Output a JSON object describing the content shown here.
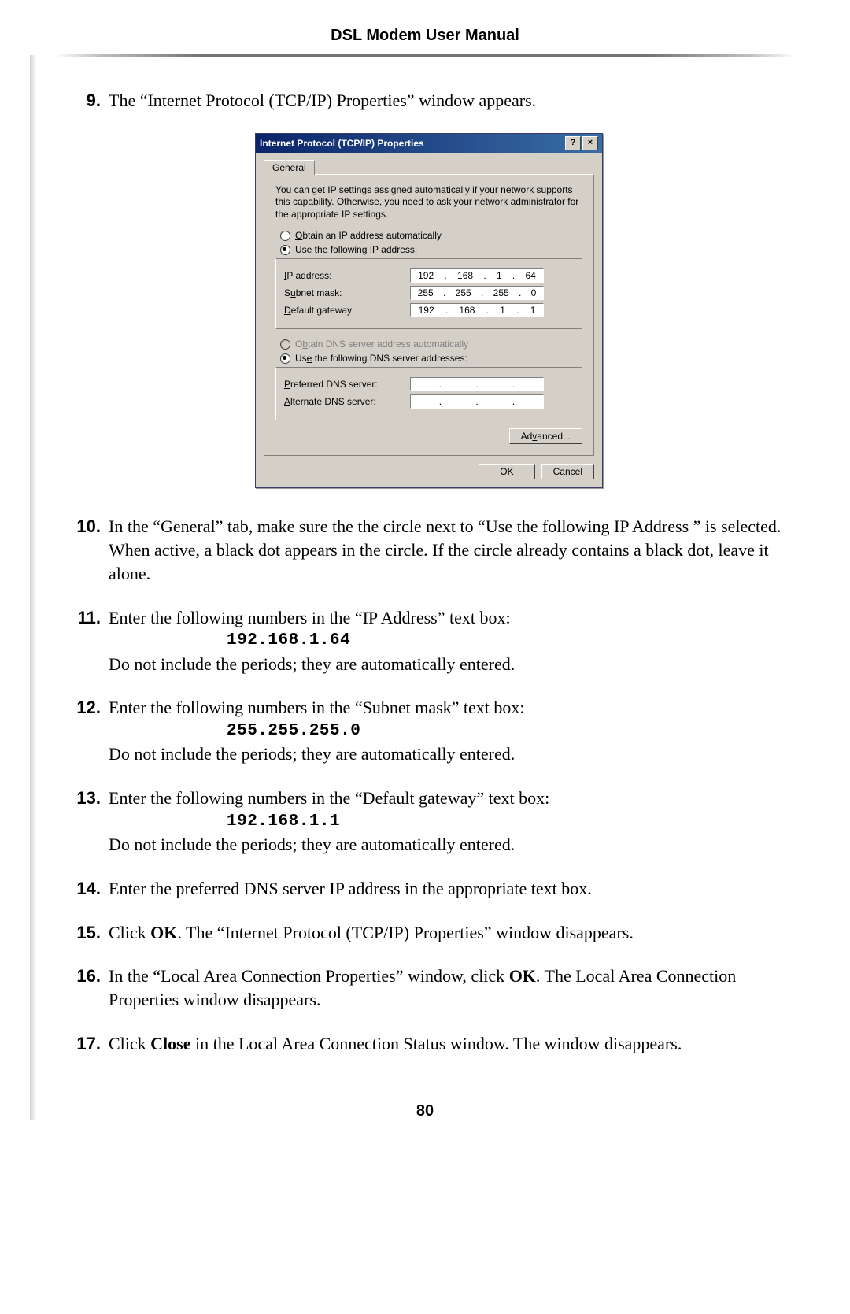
{
  "header": "DSL Modem User Manual",
  "page": "80",
  "steps": {
    "s9": {
      "num": "9.",
      "text": "The “Internet Protocol (TCP/IP) Properties” window appears."
    },
    "s10": {
      "num": "10.",
      "text": "In the “General” tab, make sure the the circle next to “Use the following IP Address ” is selected. When active, a black dot appears in the circle. If the circle already contains a black dot, leave it alone."
    },
    "s11": {
      "num": "11.",
      "lead": "Enter the following numbers in the “IP Address” text box:",
      "code": "192.168.1.64",
      "tail": "Do not include the periods; they are automatically entered."
    },
    "s12": {
      "num": "12.",
      "lead": "Enter the following numbers in the “Subnet mask” text box:",
      "code": "255.255.255.0",
      "tail": "Do not include the periods; they are automatically entered."
    },
    "s13": {
      "num": "13.",
      "lead": "Enter the following numbers in the “Default gateway” text box:",
      "code": "192.168.1.1",
      "tail": "Do not include the periods; they are automatically entered."
    },
    "s14": {
      "num": "14.",
      "text": "Enter the preferred DNS server IP address in the appropriate text box."
    },
    "s15": {
      "num": "15.",
      "a": "Click ",
      "ok": "OK",
      "b": ". The “Internet Protocol (TCP/IP) Properties” window disappears."
    },
    "s16": {
      "num": "16.",
      "a": "In the “Local Area Connection Properties” window, click ",
      "ok": "OK",
      "b": ". The Local Area Connection Properties window disappears."
    },
    "s17": {
      "num": "17.",
      "a": "Click ",
      "close": "Close",
      "b": " in the Local Area Connection Status window. The window disappears."
    }
  },
  "dlg": {
    "title": "Internet Protocol (TCP/IP) Properties",
    "help": "?",
    "x": "×",
    "tab": "General",
    "intro": "You can get IP settings assigned automatically if your network supports this capability. Otherwise, you need to ask your network administrator for the appropriate IP settings.",
    "r1": "Obtain an IP address automatically",
    "r2": "Use the following IP address:",
    "ip_lbl": "IP address:",
    "ip": {
      "a": "192",
      "b": "168",
      "c": "1",
      "d": "64"
    },
    "mask_lbl": "Subnet mask:",
    "mask": {
      "a": "255",
      "b": "255",
      "c": "255",
      "d": "0"
    },
    "gw_lbl": "Default gateway:",
    "gw": {
      "a": "192",
      "b": "168",
      "c": "1",
      "d": "1"
    },
    "r3": "Obtain DNS server address automatically",
    "r4": "Use the following DNS server addresses:",
    "pdns_lbl": "Preferred DNS server:",
    "adns_lbl": "Alternate DNS server:",
    "adv": "Advanced...",
    "ok": "OK",
    "cancel": "Cancel"
  }
}
